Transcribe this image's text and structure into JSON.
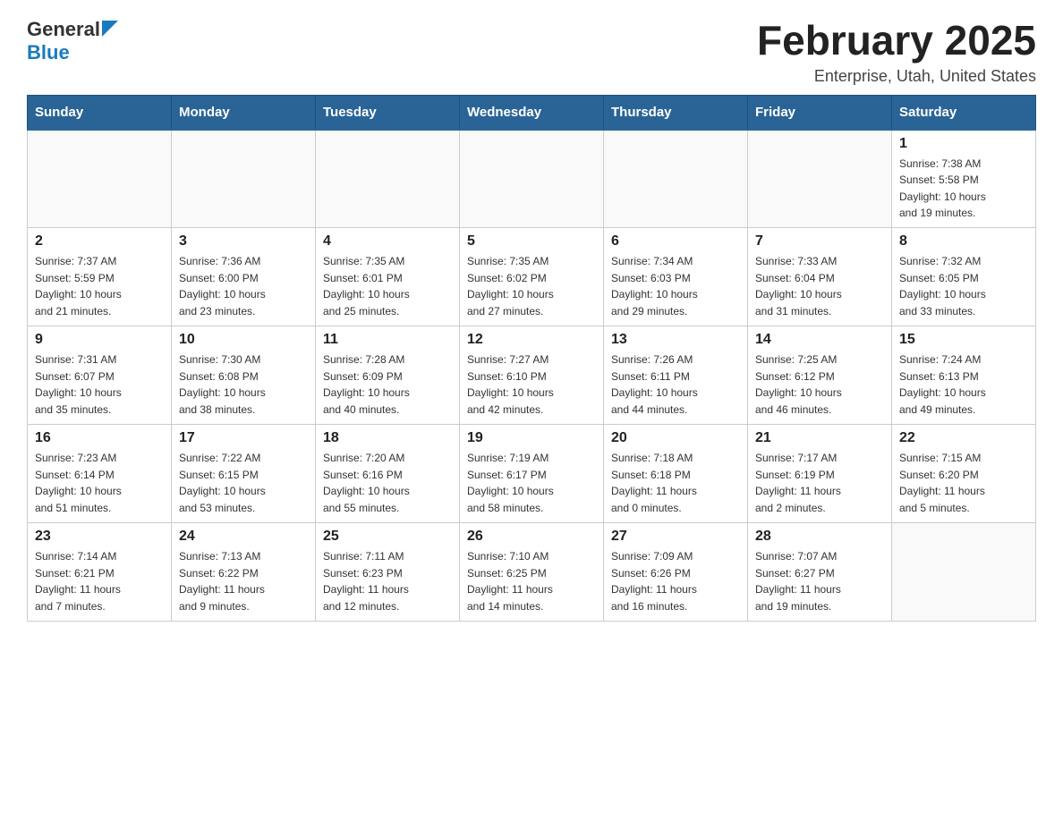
{
  "logo": {
    "general": "General",
    "blue": "Blue"
  },
  "title": "February 2025",
  "location": "Enterprise, Utah, United States",
  "days_header": [
    "Sunday",
    "Monday",
    "Tuesday",
    "Wednesday",
    "Thursday",
    "Friday",
    "Saturday"
  ],
  "weeks": [
    [
      {
        "day": "",
        "info": ""
      },
      {
        "day": "",
        "info": ""
      },
      {
        "day": "",
        "info": ""
      },
      {
        "day": "",
        "info": ""
      },
      {
        "day": "",
        "info": ""
      },
      {
        "day": "",
        "info": ""
      },
      {
        "day": "1",
        "info": "Sunrise: 7:38 AM\nSunset: 5:58 PM\nDaylight: 10 hours\nand 19 minutes."
      }
    ],
    [
      {
        "day": "2",
        "info": "Sunrise: 7:37 AM\nSunset: 5:59 PM\nDaylight: 10 hours\nand 21 minutes."
      },
      {
        "day": "3",
        "info": "Sunrise: 7:36 AM\nSunset: 6:00 PM\nDaylight: 10 hours\nand 23 minutes."
      },
      {
        "day": "4",
        "info": "Sunrise: 7:35 AM\nSunset: 6:01 PM\nDaylight: 10 hours\nand 25 minutes."
      },
      {
        "day": "5",
        "info": "Sunrise: 7:35 AM\nSunset: 6:02 PM\nDaylight: 10 hours\nand 27 minutes."
      },
      {
        "day": "6",
        "info": "Sunrise: 7:34 AM\nSunset: 6:03 PM\nDaylight: 10 hours\nand 29 minutes."
      },
      {
        "day": "7",
        "info": "Sunrise: 7:33 AM\nSunset: 6:04 PM\nDaylight: 10 hours\nand 31 minutes."
      },
      {
        "day": "8",
        "info": "Sunrise: 7:32 AM\nSunset: 6:05 PM\nDaylight: 10 hours\nand 33 minutes."
      }
    ],
    [
      {
        "day": "9",
        "info": "Sunrise: 7:31 AM\nSunset: 6:07 PM\nDaylight: 10 hours\nand 35 minutes."
      },
      {
        "day": "10",
        "info": "Sunrise: 7:30 AM\nSunset: 6:08 PM\nDaylight: 10 hours\nand 38 minutes."
      },
      {
        "day": "11",
        "info": "Sunrise: 7:28 AM\nSunset: 6:09 PM\nDaylight: 10 hours\nand 40 minutes."
      },
      {
        "day": "12",
        "info": "Sunrise: 7:27 AM\nSunset: 6:10 PM\nDaylight: 10 hours\nand 42 minutes."
      },
      {
        "day": "13",
        "info": "Sunrise: 7:26 AM\nSunset: 6:11 PM\nDaylight: 10 hours\nand 44 minutes."
      },
      {
        "day": "14",
        "info": "Sunrise: 7:25 AM\nSunset: 6:12 PM\nDaylight: 10 hours\nand 46 minutes."
      },
      {
        "day": "15",
        "info": "Sunrise: 7:24 AM\nSunset: 6:13 PM\nDaylight: 10 hours\nand 49 minutes."
      }
    ],
    [
      {
        "day": "16",
        "info": "Sunrise: 7:23 AM\nSunset: 6:14 PM\nDaylight: 10 hours\nand 51 minutes."
      },
      {
        "day": "17",
        "info": "Sunrise: 7:22 AM\nSunset: 6:15 PM\nDaylight: 10 hours\nand 53 minutes."
      },
      {
        "day": "18",
        "info": "Sunrise: 7:20 AM\nSunset: 6:16 PM\nDaylight: 10 hours\nand 55 minutes."
      },
      {
        "day": "19",
        "info": "Sunrise: 7:19 AM\nSunset: 6:17 PM\nDaylight: 10 hours\nand 58 minutes."
      },
      {
        "day": "20",
        "info": "Sunrise: 7:18 AM\nSunset: 6:18 PM\nDaylight: 11 hours\nand 0 minutes."
      },
      {
        "day": "21",
        "info": "Sunrise: 7:17 AM\nSunset: 6:19 PM\nDaylight: 11 hours\nand 2 minutes."
      },
      {
        "day": "22",
        "info": "Sunrise: 7:15 AM\nSunset: 6:20 PM\nDaylight: 11 hours\nand 5 minutes."
      }
    ],
    [
      {
        "day": "23",
        "info": "Sunrise: 7:14 AM\nSunset: 6:21 PM\nDaylight: 11 hours\nand 7 minutes."
      },
      {
        "day": "24",
        "info": "Sunrise: 7:13 AM\nSunset: 6:22 PM\nDaylight: 11 hours\nand 9 minutes."
      },
      {
        "day": "25",
        "info": "Sunrise: 7:11 AM\nSunset: 6:23 PM\nDaylight: 11 hours\nand 12 minutes."
      },
      {
        "day": "26",
        "info": "Sunrise: 7:10 AM\nSunset: 6:25 PM\nDaylight: 11 hours\nand 14 minutes."
      },
      {
        "day": "27",
        "info": "Sunrise: 7:09 AM\nSunset: 6:26 PM\nDaylight: 11 hours\nand 16 minutes."
      },
      {
        "day": "28",
        "info": "Sunrise: 7:07 AM\nSunset: 6:27 PM\nDaylight: 11 hours\nand 19 minutes."
      },
      {
        "day": "",
        "info": ""
      }
    ]
  ]
}
